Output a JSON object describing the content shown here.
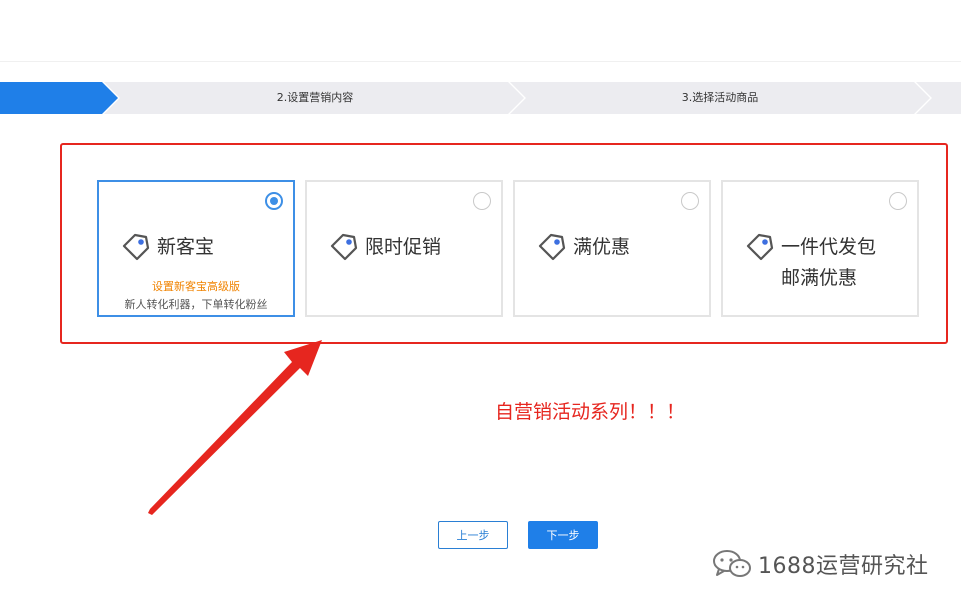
{
  "steps": [
    {
      "label": "",
      "state": "active"
    },
    {
      "label": "2.设置营销内容",
      "state": "pending"
    },
    {
      "label": "3.选择活动商品",
      "state": "pending"
    }
  ],
  "cards": [
    {
      "title_line1": "新客宝",
      "title_line2": "",
      "sub1": "设置新客宝高级版",
      "sub2": "新人转化利器，下单转化粉丝",
      "selected": true
    },
    {
      "title_line1": "限时促销",
      "title_line2": "",
      "sub1": "",
      "sub2": "",
      "selected": false
    },
    {
      "title_line1": "满优惠",
      "title_line2": "",
      "sub1": "",
      "sub2": "",
      "selected": false
    },
    {
      "title_line1": "一件代发包",
      "title_line2": "邮满优惠",
      "sub1": "",
      "sub2": "",
      "selected": false
    }
  ],
  "annotation": "自营销活动系列！！！",
  "buttons": {
    "prev": "上一步",
    "next": "下一步"
  },
  "watermark": {
    "text": "1688运营研究社",
    "icon": "wechat-icon"
  },
  "colors": {
    "accent": "#1f7fe8",
    "highlight": "#e6261f",
    "orange_link": "#f08300",
    "step_bg": "#ececf0"
  }
}
